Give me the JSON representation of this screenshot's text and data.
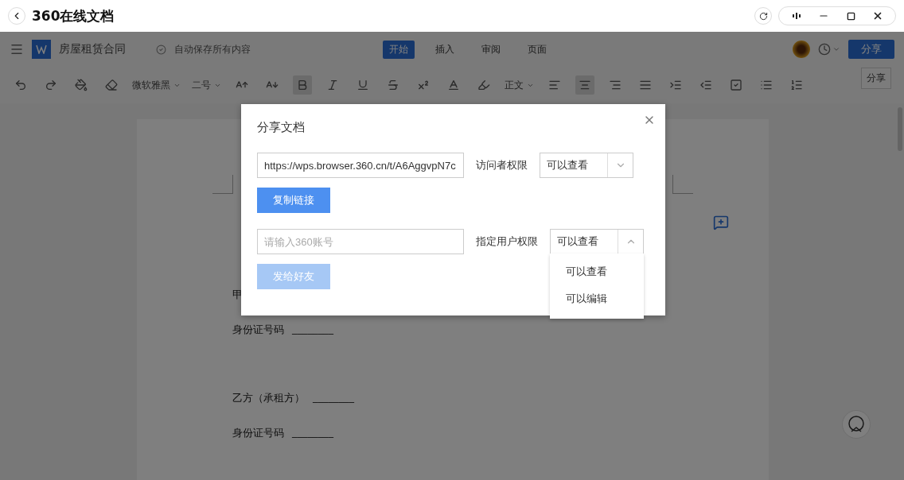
{
  "window": {
    "title": "360在线文档"
  },
  "doc_header": {
    "filename": "房屋租赁合同",
    "save_status": "自动保存所有内容",
    "tabs": [
      {
        "label": "开始",
        "selected": true
      },
      {
        "label": "插入",
        "selected": false
      },
      {
        "label": "审阅",
        "selected": false
      },
      {
        "label": "页面",
        "selected": false
      }
    ],
    "share_button": "分享",
    "tooltip": "分享"
  },
  "toolbar": {
    "font": "微软雅黑",
    "size": "二号",
    "style": "正文",
    "format_buttons": [
      {
        "kind": "bold",
        "selected": true
      },
      {
        "kind": "italic",
        "selected": false
      },
      {
        "kind": "underline",
        "selected": false
      },
      {
        "kind": "strike",
        "selected": false
      }
    ],
    "align_buttons": [
      {
        "kind": "left",
        "selected": false
      },
      {
        "kind": "center",
        "selected": true
      },
      {
        "kind": "right",
        "selected": false
      },
      {
        "kind": "justify",
        "selected": false
      }
    ]
  },
  "document": {
    "lines": [
      {
        "label": "甲"
      },
      {
        "label": "身份证号码",
        "blank": "________"
      },
      {
        "label": "乙方（承租方）",
        "blank": "________"
      },
      {
        "label": "身份证号码",
        "blank": "________"
      }
    ]
  },
  "share_dialog": {
    "title": "分享文档",
    "link_field": {
      "value": "https://wps.browser.360.cn/t/A6AggvpN7c"
    },
    "visitor_label": "访问者权限",
    "visitor_select": {
      "value": "可以查看",
      "expanded": false
    },
    "copy_button": {
      "label": "复制链接",
      "disabled": false
    },
    "account_field": {
      "placeholder": "请输入360账号"
    },
    "user_label": "指定用户权限",
    "user_select": {
      "value": "可以查看",
      "expanded": true,
      "options": [
        "可以查看",
        "可以编辑"
      ]
    },
    "send_button": {
      "label": "发给好友",
      "disabled": true
    }
  }
}
